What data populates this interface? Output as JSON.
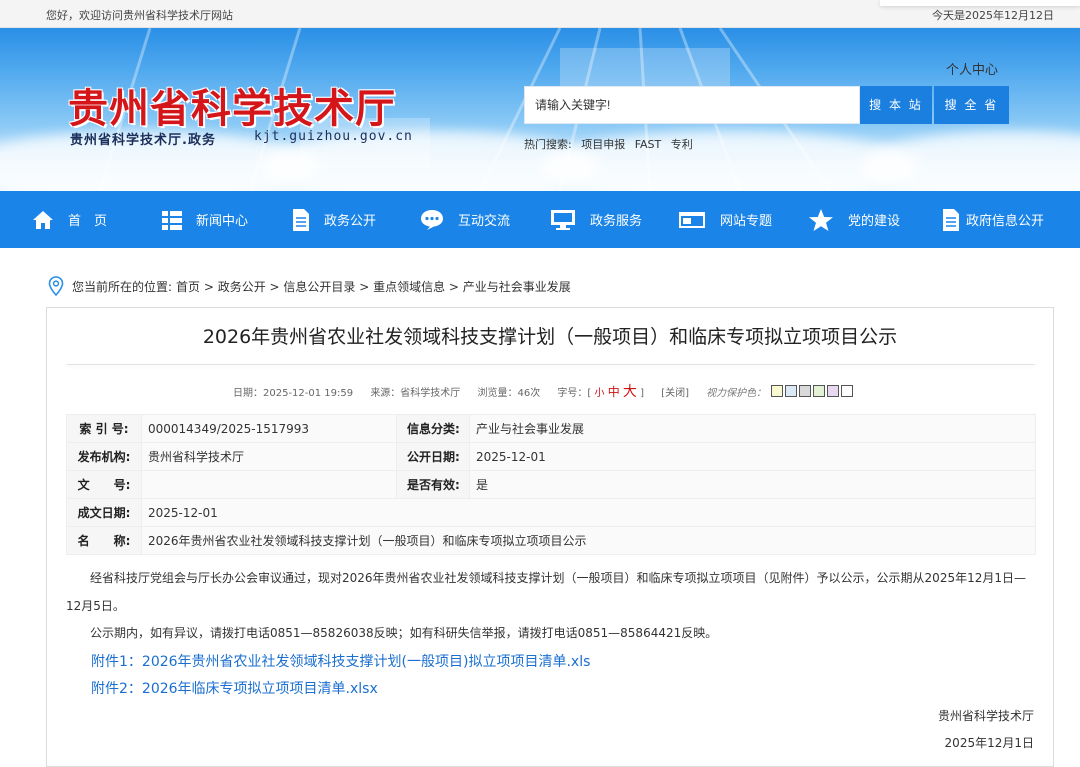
{
  "topbar": {
    "welcome": "您好，欢迎访问贵州省科学技术厅网站",
    "date": "今天是2025年12月12日"
  },
  "header": {
    "title": "贵州省科学技术厅",
    "subtitle": "贵州省科学技术厅.政务",
    "domain": "kjt.guizhou.gov.cn",
    "personal_center": "个人中心",
    "search_placeholder": "请输入关键字!",
    "search_site": "搜 本 站",
    "search_province": "搜 全 省",
    "hot_label": "热门搜索:",
    "hot_terms": [
      "项目申报",
      "FAST",
      "专利"
    ]
  },
  "nav": [
    {
      "label": "首　页",
      "icon": "home-icon"
    },
    {
      "label": "新闻中心",
      "icon": "grid-list-icon"
    },
    {
      "label": "政务公开",
      "icon": "document-icon"
    },
    {
      "label": "互动交流",
      "icon": "chat-bubble-icon"
    },
    {
      "label": "政务服务",
      "icon": "monitor-icon"
    },
    {
      "label": "网站专题",
      "icon": "window-icon"
    },
    {
      "label": "党的建设",
      "icon": "star-icon"
    },
    {
      "label": "政府信息公开",
      "icon": "file-icon"
    }
  ],
  "breadcrumb": {
    "prefix": "您当前所在的位置:",
    "path": "首页 > 政务公开 > 信息公开目录 > 重点领域信息 > 产业与社会事业发展"
  },
  "article": {
    "title": "2026年贵州省农业社发领域科技支撑计划（一般项目）和临床专项拟立项项目公示",
    "meta": {
      "date": "日期：2025-12-01 19:59",
      "source": "来源：省科学技术厅",
      "views": "浏览量：46次",
      "font_size_label": "字号：[",
      "small": "小",
      "medium": "中",
      "large": "大",
      "bracket_close": "]",
      "close": "[关闭]",
      "vision_label": "视力保护色：",
      "swatches": [
        "#fafad2",
        "#dbe9f7",
        "#d9d9d9",
        "#e3f1d4",
        "#e8d9f1",
        "#ffffff"
      ]
    },
    "info": {
      "index_label": "索 引 号:",
      "index_value": "000014349/2025-1517993",
      "category_label": "信息分类:",
      "category_value": "产业与社会事业发展",
      "publisher_label": "发布机构:",
      "publisher_value": "贵州省科学技术厅",
      "public_date_label": "公开日期:",
      "public_date_value": "2025-12-01",
      "doc_no_label": "文　　号:",
      "doc_no_value": "",
      "valid_label": "是否有效:",
      "valid_value": "是",
      "written_date_label": "成文日期:",
      "written_date_value": "2025-12-01",
      "name_label": "名　　称:",
      "name_value": "2026年贵州省农业社发领域科技支撑计划（一般项目）和临床专项拟立项项目公示"
    },
    "paragraph1": "经省科技厅党组会与厅长办公会审议通过，现对2026年贵州省农业社发领域科技支撑计划（一般项目）和临床专项拟立项项目（见附件）予以公示，公示期从2025年12月1日—12月5日。",
    "paragraph2": "公示期内，如有异议，请拨打电话0851—85826038反映；如有科研失信举报，请拨打电话0851—85864421反映。",
    "attachment1": "附件1：2026年贵州省农业社发领域科技支撑计划(一般项目)拟立项项目清单.xls",
    "attachment2": "附件2：2026年临床专项拟立项项目清单.xlsx",
    "signature": "贵州省科学技术厅",
    "sign_date": "2025年12月1日"
  },
  "colors": {
    "nav_bg": "#1a84e8",
    "title_red": "#d4161a",
    "link_blue": "#1a6fd0",
    "search_btn": "#1b7fe0"
  }
}
